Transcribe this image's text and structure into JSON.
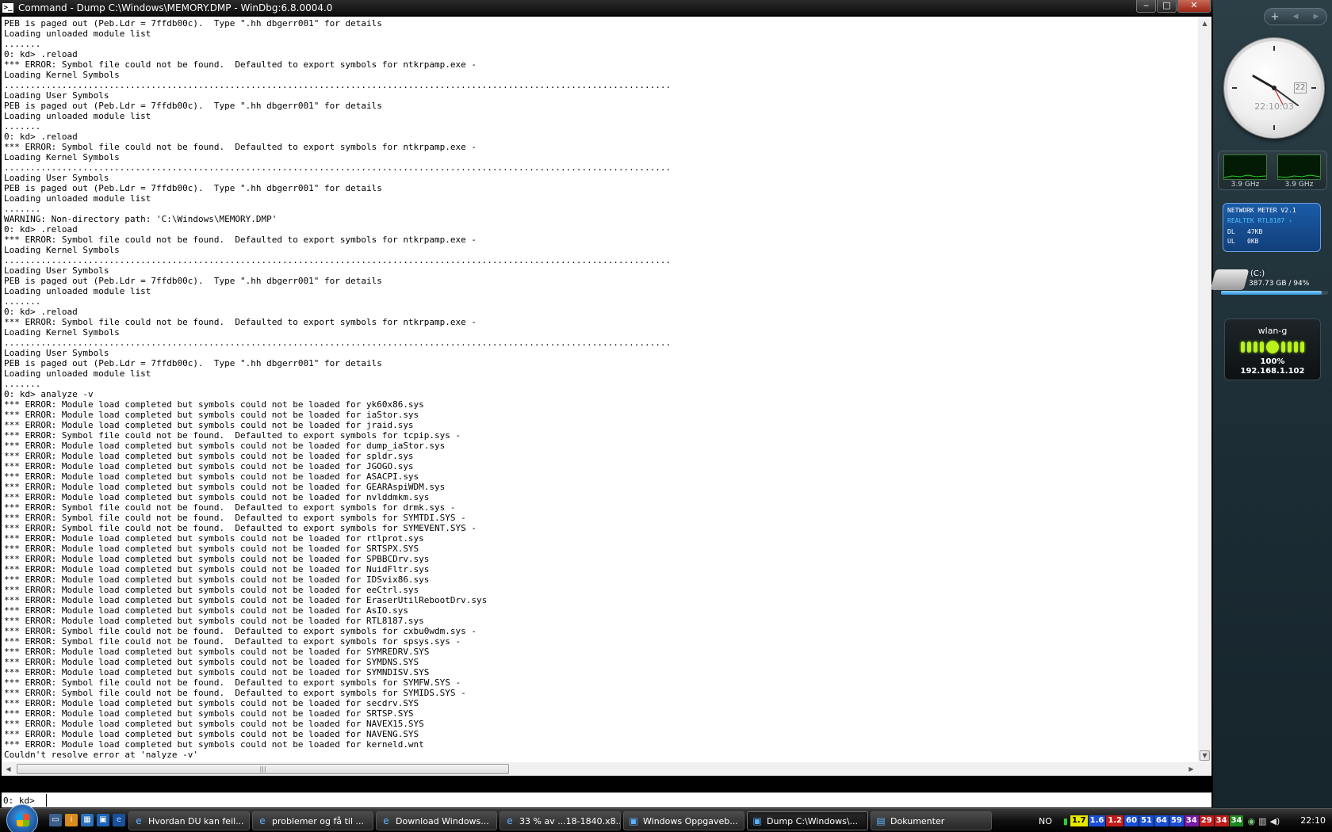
{
  "window": {
    "title": "Command - Dump C:\\Windows\\MEMORY.DMP - WinDbg:6.8.0004.0",
    "icon_text": ">_",
    "min": "‒",
    "max": "□",
    "close": "✕"
  },
  "log_lines": [
    "PEB is paged out (Peb.Ldr = 7ffdb00c).  Type \".hh dbgerr001\" for details",
    "Loading unloaded module list",
    ".......",
    "0: kd> .reload",
    "*** ERROR: Symbol file could not be found.  Defaulted to export symbols for ntkrpamp.exe -",
    "Loading Kernel Symbols",
    "...............................................................................................................................",
    "Loading User Symbols",
    "PEB is paged out (Peb.Ldr = 7ffdb00c).  Type \".hh dbgerr001\" for details",
    "Loading unloaded module list",
    ".......",
    "0: kd> .reload",
    "*** ERROR: Symbol file could not be found.  Defaulted to export symbols for ntkrpamp.exe -",
    "Loading Kernel Symbols",
    "...............................................................................................................................",
    "Loading User Symbols",
    "PEB is paged out (Peb.Ldr = 7ffdb00c).  Type \".hh dbgerr001\" for details",
    "Loading unloaded module list",
    ".......",
    "WARNING: Non-directory path: 'C:\\Windows\\MEMORY.DMP'",
    "0: kd> .reload",
    "*** ERROR: Symbol file could not be found.  Defaulted to export symbols for ntkrpamp.exe -",
    "Loading Kernel Symbols",
    "...............................................................................................................................",
    "Loading User Symbols",
    "PEB is paged out (Peb.Ldr = 7ffdb00c).  Type \".hh dbgerr001\" for details",
    "Loading unloaded module list",
    ".......",
    "0: kd> .reload",
    "*** ERROR: Symbol file could not be found.  Defaulted to export symbols for ntkrpamp.exe -",
    "Loading Kernel Symbols",
    "...............................................................................................................................",
    "Loading User Symbols",
    "PEB is paged out (Peb.Ldr = 7ffdb00c).  Type \".hh dbgerr001\" for details",
    "Loading unloaded module list",
    ".......",
    "0: kd> analyze -v",
    "*** ERROR: Module load completed but symbols could not be loaded for yk60x86.sys",
    "*** ERROR: Module load completed but symbols could not be loaded for iaStor.sys",
    "*** ERROR: Module load completed but symbols could not be loaded for jraid.sys",
    "*** ERROR: Symbol file could not be found.  Defaulted to export symbols for tcpip.sys -",
    "*** ERROR: Module load completed but symbols could not be loaded for dump_iaStor.sys",
    "*** ERROR: Module load completed but symbols could not be loaded for spldr.sys",
    "*** ERROR: Module load completed but symbols could not be loaded for JGOGO.sys",
    "*** ERROR: Module load completed but symbols could not be loaded for ASACPI.sys",
    "*** ERROR: Module load completed but symbols could not be loaded for GEARAspiWDM.sys",
    "*** ERROR: Module load completed but symbols could not be loaded for nvlddmkm.sys",
    "*** ERROR: Symbol file could not be found.  Defaulted to export symbols for drmk.sys -",
    "*** ERROR: Symbol file could not be found.  Defaulted to export symbols for SYMTDI.SYS -",
    "*** ERROR: Symbol file could not be found.  Defaulted to export symbols for SYMEVENT.SYS -",
    "*** ERROR: Module load completed but symbols could not be loaded for rtlprot.sys",
    "*** ERROR: Module load completed but symbols could not be loaded for SRTSPX.SYS",
    "*** ERROR: Module load completed but symbols could not be loaded for SPBBCDrv.sys",
    "*** ERROR: Module load completed but symbols could not be loaded for NuidFltr.sys",
    "*** ERROR: Module load completed but symbols could not be loaded for IDSvix86.sys",
    "*** ERROR: Module load completed but symbols could not be loaded for eeCtrl.sys",
    "*** ERROR: Module load completed but symbols could not be loaded for EraserUtilRebootDrv.sys",
    "*** ERROR: Module load completed but symbols could not be loaded for AsIO.sys",
    "*** ERROR: Module load completed but symbols could not be loaded for RTL8187.sys",
    "*** ERROR: Symbol file could not be found.  Defaulted to export symbols for cxbu0wdm.sys -",
    "*** ERROR: Symbol file could not be found.  Defaulted to export symbols for spsys.sys -",
    "*** ERROR: Module load completed but symbols could not be loaded for SYMREDRV.SYS",
    "*** ERROR: Module load completed but symbols could not be loaded for SYMDNS.SYS",
    "*** ERROR: Module load completed but symbols could not be loaded for SYMNDISV.SYS",
    "*** ERROR: Symbol file could not be found.  Defaulted to export symbols for SYMFW.SYS -",
    "*** ERROR: Symbol file could not be found.  Defaulted to export symbols for SYMIDS.SYS -",
    "*** ERROR: Module load completed but symbols could not be loaded for secdrv.SYS",
    "*** ERROR: Module load completed but symbols could not be loaded for SRTSP.SYS",
    "*** ERROR: Module load completed but symbols could not be loaded for NAVEX15.SYS",
    "*** ERROR: Module load completed but symbols could not be loaded for NAVENG.SYS",
    "*** ERROR: Module load completed but symbols could not be loaded for kerneld.wnt",
    "Couldn't resolve error at 'nalyze -v'"
  ],
  "command": {
    "prompt": "0: kd>",
    "value": ""
  },
  "sidebar": {
    "add": "+",
    "prev": "◀",
    "next": "▶",
    "clock": {
      "date": "22",
      "time": "22:10:03"
    },
    "cpu": {
      "core1": "3.9 GHz",
      "core2": "3.9 GHz"
    },
    "network_meter": {
      "title": "NETWORK METER V2.1",
      "adapter": "REALTEK RTL8187 ›",
      "dl_label": "DL",
      "dl_value": "47KB",
      "ul_label": "UL",
      "ul_value": "0KB"
    },
    "drive": {
      "name": "(C:)",
      "info": "387.73 GB / 94%",
      "fill_percent": 94
    },
    "wlan": {
      "name": "wlan-g",
      "signal": "100%",
      "ip": "192.168.1.102"
    }
  },
  "taskbar": {
    "tasks": [
      {
        "label": "Hvordan DU kan feil...",
        "icon": "e"
      },
      {
        "label": "problemer og få til ...",
        "icon": "e"
      },
      {
        "label": "Download Windows...",
        "icon": "e"
      },
      {
        "label": "33 % av ...18-1840.x8...",
        "icon": "e"
      },
      {
        "label": "Windows Oppgaveb...",
        "icon": "▣"
      },
      {
        "label": "Dump C:\\Windows\\...",
        "icon": "▣"
      },
      {
        "label": "Dokumenter",
        "icon": "▤"
      }
    ],
    "lang": "NO",
    "tray_values": [
      "1.7",
      "1.6",
      "1.2",
      "60",
      "51",
      "64",
      "59",
      "34",
      "29",
      "34",
      "34"
    ],
    "tray_colors": [
      "#e6e600",
      "#1a4fd6",
      "#c21c1c",
      "#1a4fd6",
      "#1a4fd6",
      "#1a4fd6",
      "#1a4fd6",
      "#7a1ca8",
      "#c21c1c",
      "#c21c1c",
      "#1c8a1c"
    ],
    "time": "22:10"
  }
}
